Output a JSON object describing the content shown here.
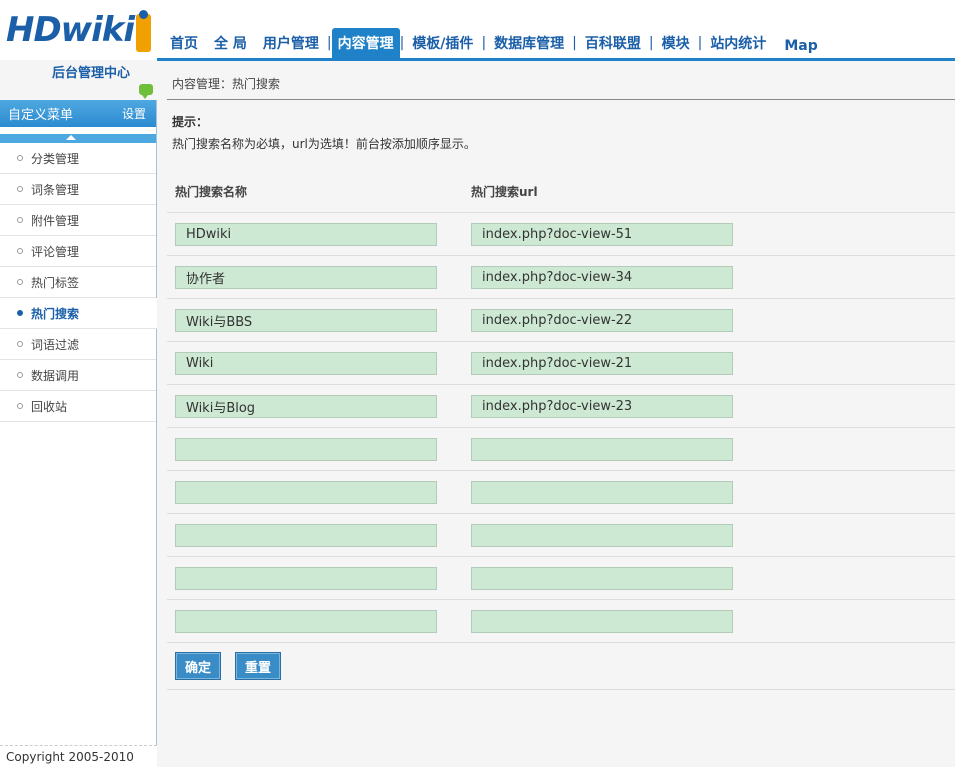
{
  "logo": {
    "text": "HDwiki",
    "subtitle": "后台管理中心"
  },
  "nav": {
    "items": [
      {
        "label": "首页",
        "active": false
      },
      {
        "label": "全 局",
        "active": false
      },
      {
        "label": "用户管理",
        "active": false
      },
      {
        "label": "内容管理",
        "active": true
      },
      {
        "label": "模板/插件",
        "active": false
      },
      {
        "label": "数据库管理",
        "active": false
      },
      {
        "label": "百科联盟",
        "active": false
      },
      {
        "label": "模块",
        "active": false
      },
      {
        "label": "站内统计",
        "active": false
      }
    ],
    "separator": "|",
    "map_label": "Map"
  },
  "sidebar": {
    "title": "自定义菜单",
    "settings_label": "设置",
    "items": [
      {
        "label": "分类管理"
      },
      {
        "label": "词条管理"
      },
      {
        "label": "附件管理"
      },
      {
        "label": "评论管理"
      },
      {
        "label": "热门标签"
      },
      {
        "label": "热门搜索"
      },
      {
        "label": "词语过滤"
      },
      {
        "label": "数据调用"
      },
      {
        "label": "回收站"
      }
    ],
    "active_index": 5,
    "copyright": "Copyright 2005-2010"
  },
  "content": {
    "breadcrumb": "内容管理：热门搜索",
    "tip_title": "提示：",
    "tip_text": "热门搜索名称为必填，url为选填！前台按添加顺序显示。",
    "col_name": "热门搜索名称",
    "col_url": "热门搜索url",
    "rows": [
      {
        "name": "HDwiki",
        "url": "index.php?doc-view-51"
      },
      {
        "name": "协作者",
        "url": "index.php?doc-view-34"
      },
      {
        "name": "Wiki与BBS",
        "url": "index.php?doc-view-22"
      },
      {
        "name": "Wiki",
        "url": "index.php?doc-view-21"
      },
      {
        "name": "Wiki与Blog",
        "url": "index.php?doc-view-23"
      },
      {
        "name": "",
        "url": ""
      },
      {
        "name": "",
        "url": ""
      },
      {
        "name": "",
        "url": ""
      },
      {
        "name": "",
        "url": ""
      },
      {
        "name": "",
        "url": ""
      }
    ],
    "submit_label": "确定",
    "reset_label": "重置"
  },
  "colors": {
    "brand": "#1a5fa8",
    "accent": "#1f82c8",
    "field_bg": "#cde8d3"
  }
}
